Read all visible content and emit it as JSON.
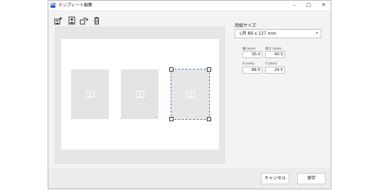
{
  "window": {
    "title": "テンプレート編集",
    "app_icon_label": "Ps",
    "controls": {
      "minimize": "–",
      "maximize": "□",
      "close": "✕"
    }
  },
  "toolbar": {
    "buttons": [
      {
        "icon": "add-photo-icon"
      },
      {
        "icon": "portrait-icon"
      },
      {
        "icon": "rotate-icon"
      },
      {
        "icon": "trash-icon"
      }
    ]
  },
  "canvas": {
    "slots": [
      {
        "icon": "image-icon",
        "selected": false
      },
      {
        "icon": "image-icon",
        "selected": false
      },
      {
        "icon": "image-icon",
        "selected": true
      }
    ]
  },
  "properties": {
    "paper_size_label": "用紙サイズ",
    "paper_size_value": "L判 89 x 127 mm",
    "width_label": "幅 (mm)",
    "width_value": "30.0",
    "height_label": "高さ (mm)",
    "height_value": "40.0",
    "x_label": "X (mm)",
    "x_value": "88.5",
    "y_label": "Y (mm)",
    "y_value": "24.5"
  },
  "footer": {
    "cancel_label": "キャンセル",
    "save_label": "保存"
  }
}
